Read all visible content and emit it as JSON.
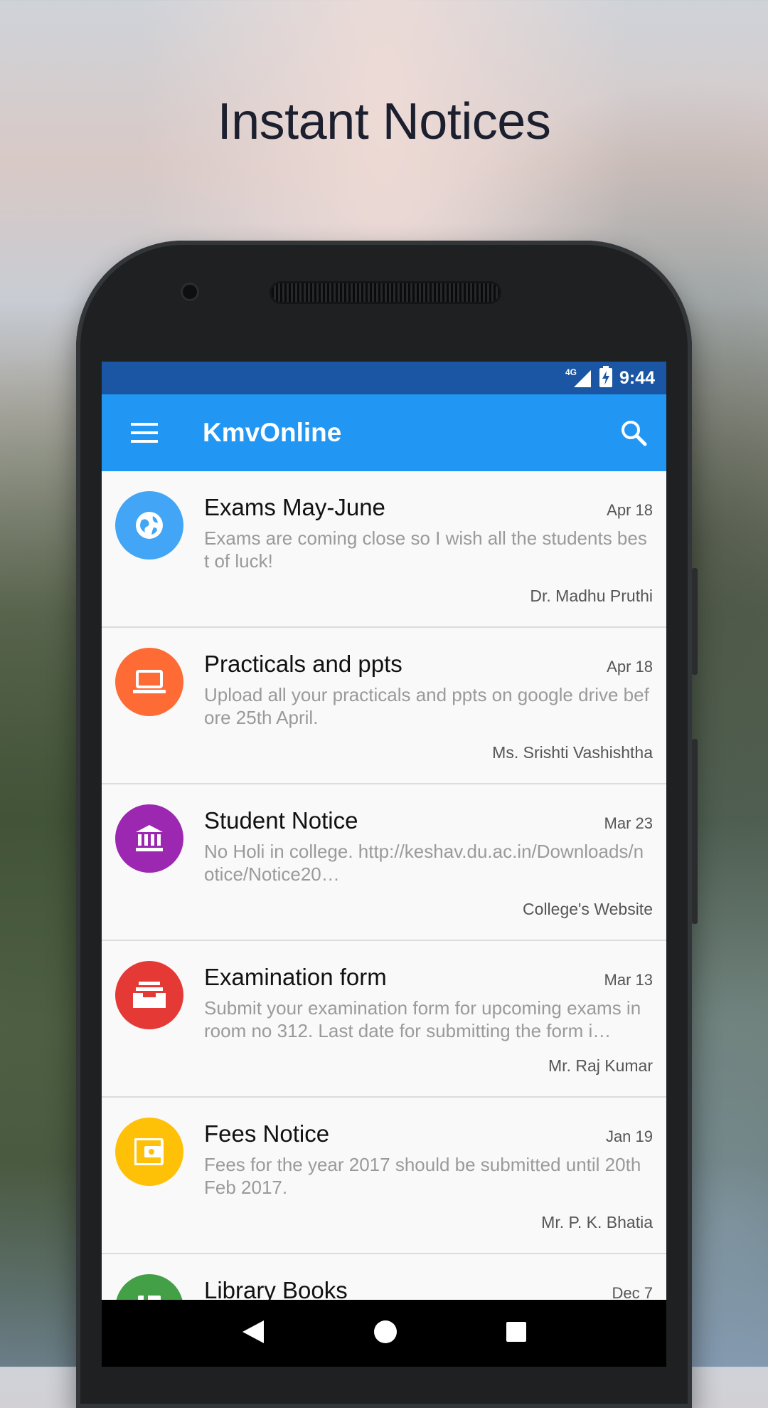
{
  "headline": "Instant Notices",
  "status": {
    "network": "4G",
    "time": "9:44"
  },
  "appbar": {
    "title": "KmvOnline"
  },
  "notices": [
    {
      "title": "Exams May-June",
      "date": "Apr 18",
      "body": "Exams are coming close so I wish all the students best of luck!",
      "author": "Dr. Madhu Pruthi",
      "icon": "globe-icon",
      "color": "#42a5f5"
    },
    {
      "title": "Practicals and ppts",
      "date": "Apr 18",
      "body": "Upload all your practicals and ppts on google drive before 25th April.",
      "author": "Ms. Srishti Vashishtha",
      "icon": "laptop-icon",
      "color": "#ff6b35"
    },
    {
      "title": "Student Notice",
      "date": "Mar 23",
      "body": "No Holi in college. http://keshav.du.ac.in/Downloads/notice/Notice20…",
      "author": "College's Website",
      "icon": "bank-icon",
      "color": "#9c27b0"
    },
    {
      "title": "Examination form",
      "date": "Mar 13",
      "body": "Submit your examination form for upcoming exams in room no 312. Last date for submitting the form i…",
      "author": "Mr. Raj Kumar",
      "icon": "inbox-tray-icon",
      "color": "#e53935"
    },
    {
      "title": "Fees Notice",
      "date": "Jan 19",
      "body": "Fees for the year 2017 should be submitted until 20th Feb 2017.",
      "author": "Mr. P. K. Bhatia",
      "icon": "wallet-icon",
      "color": "#ffc107"
    },
    {
      "title": "Library Books",
      "date": "Dec 7",
      "body": "",
      "author": "",
      "icon": "book-icon",
      "color": "#43a047"
    }
  ]
}
